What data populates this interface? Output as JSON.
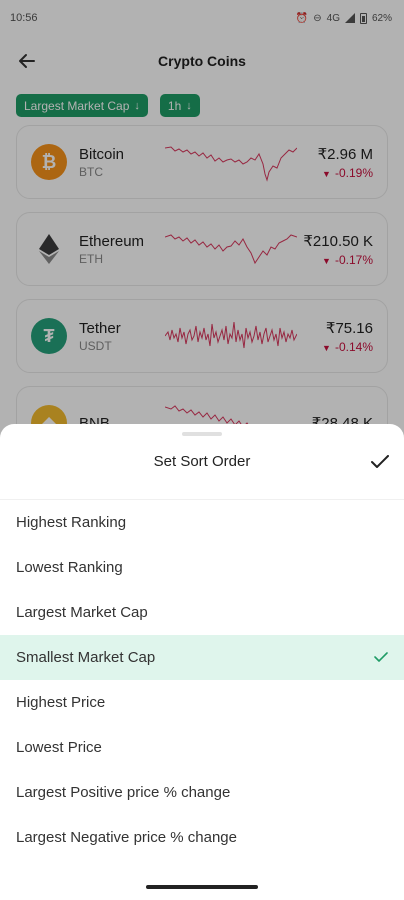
{
  "status_bar": {
    "time": "10:56",
    "network": "4G",
    "battery": "62%",
    "icons": [
      "alarm-icon",
      "dnd-icon",
      "volte-icon",
      "signal-icon",
      "battery-icon"
    ]
  },
  "app": {
    "title": "Crypto Coins",
    "back_icon": "arrow-left-icon",
    "filters": [
      {
        "label": "Largest Market Cap",
        "icon": "arrow-down-icon"
      },
      {
        "label": "1h",
        "icon": "arrow-down-icon"
      }
    ],
    "accent_color": "#1f9c66",
    "negative_color": "#c8103e",
    "coins": [
      {
        "name": "Bitcoin",
        "symbol": "BTC",
        "price": "₹2.96 M",
        "change": "-0.19%",
        "logo_color": "#f7931a",
        "logo_icon": "bitcoin-icon"
      },
      {
        "name": "Ethereum",
        "symbol": "ETH",
        "price": "₹210.50 K",
        "change": "-0.17%",
        "logo_color": "#ffffff",
        "logo_icon": "ethereum-icon"
      },
      {
        "name": "Tether",
        "symbol": "USDT",
        "price": "₹75.16",
        "change": "-0.14%",
        "logo_color": "#26a17b",
        "logo_icon": "tether-icon"
      },
      {
        "name": "BNB",
        "symbol": "",
        "price": "₹28.48 K",
        "change": "",
        "logo_color": "#f3ba2f",
        "logo_icon": "bnb-icon"
      }
    ]
  },
  "sheet": {
    "title": "Set Sort Order",
    "confirm_icon": "check-icon",
    "selected_color": "#dff5ec",
    "options": [
      {
        "label": "Highest Ranking",
        "selected": false
      },
      {
        "label": "Lowest Ranking",
        "selected": false
      },
      {
        "label": "Largest Market Cap",
        "selected": false
      },
      {
        "label": "Smallest Market Cap",
        "selected": true
      },
      {
        "label": "Highest Price",
        "selected": false
      },
      {
        "label": "Lowest Price",
        "selected": false
      },
      {
        "label": "Largest Positive price % change",
        "selected": false
      },
      {
        "label": "Largest Negative price % change",
        "selected": false
      }
    ]
  }
}
